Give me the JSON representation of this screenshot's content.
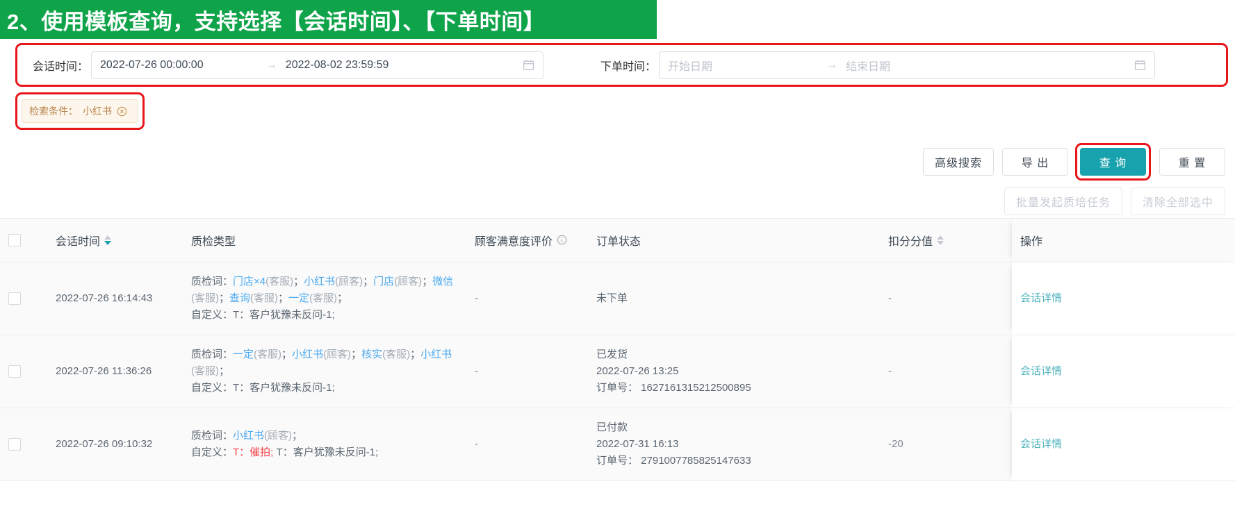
{
  "banner": {
    "text": "2、使用模板查询，支持选择【会话时间】、【下单时间】",
    "bg_color": "#0FA44A"
  },
  "filters": {
    "session_time": {
      "label": "会话时间：",
      "start_value": "2022-07-26 00:00:00",
      "end_value": "2022-08-02 23:59:59",
      "separator": "→",
      "calendar_icon": "calendar-icon"
    },
    "order_time": {
      "label": "下单时间：",
      "start_placeholder": "开始日期",
      "end_placeholder": "结束日期",
      "separator": "→",
      "calendar_icon": "calendar-icon"
    },
    "highlight_color": "#E8151A"
  },
  "condition_tag": {
    "label": "检索条件：",
    "value": "小红书",
    "close_icon": "close-circle-icon",
    "text_color": "#B8834A",
    "bg_color": "#FDF6EC"
  },
  "actions": {
    "advanced_search": "高级搜索",
    "export": "导 出",
    "query": "查 询",
    "reset": "重 置",
    "primary_color": "#17A2AD"
  },
  "toolbar": {
    "batch_task": "批量发起质培任务",
    "clear_selection": "清除全部选中"
  },
  "table": {
    "headers": {
      "checkbox": "",
      "session_time": "会话时间",
      "qc_type": "质检类型",
      "satisfaction": "顾客满意度评价",
      "order_status": "订单状态",
      "score": "扣分分值",
      "operation": "操作"
    },
    "rows": [
      {
        "session_time": "2022-07-26 16:14:43",
        "qc": {
          "prefix": "质检词：",
          "keywords": [
            {
              "word": "门店×4",
              "role": "(客服)"
            },
            {
              "word": "小红书",
              "role": "(顾客)"
            },
            {
              "word": "门店",
              "role": "(顾客)"
            },
            {
              "word": "微信",
              "role": "(客服)"
            },
            {
              "word": "查询",
              "role": "(客服)"
            },
            {
              "word": "一定",
              "role": "(客服)"
            }
          ],
          "custom_prefix": "自定义：",
          "custom_items": [
            {
              "text": "T：客户犹豫未反问-1;",
              "color": "normal"
            }
          ]
        },
        "satisfaction": "-",
        "order_status": "未下单",
        "order_time": "",
        "order_no_label": "",
        "order_no": "",
        "score": "-",
        "operation": "会话详情"
      },
      {
        "session_time": "2022-07-26 11:36:26",
        "qc": {
          "prefix": "质检词：",
          "keywords": [
            {
              "word": "一定",
              "role": "(客服)"
            },
            {
              "word": "小红书",
              "role": "(顾客)"
            },
            {
              "word": "核实",
              "role": "(客服)"
            },
            {
              "word": "小红书",
              "role": "(客服)"
            }
          ],
          "custom_prefix": "自定义：",
          "custom_items": [
            {
              "text": "T：客户犹豫未反问-1;",
              "color": "normal"
            }
          ]
        },
        "satisfaction": "-",
        "order_status": "已发货",
        "order_time": "2022-07-26 13:25",
        "order_no_label": "订单号：",
        "order_no": "1627161315212500895",
        "score": "-",
        "operation": "会话详情"
      },
      {
        "session_time": "2022-07-26 09:10:32",
        "qc": {
          "prefix": "质检词：",
          "keywords": [
            {
              "word": "小红书",
              "role": "(顾客)"
            }
          ],
          "custom_prefix": "自定义：",
          "custom_items": [
            {
              "text": "T：催拍;",
              "color": "red"
            },
            {
              "text": "T：客户犹豫未反问-1;",
              "color": "normal"
            }
          ]
        },
        "satisfaction": "-",
        "order_status": "已付款",
        "order_time": "2022-07-31 16:13",
        "order_no_label": "订单号：",
        "order_no": "2791007785825147633",
        "score": "-20",
        "operation": "会话详情"
      }
    ]
  }
}
